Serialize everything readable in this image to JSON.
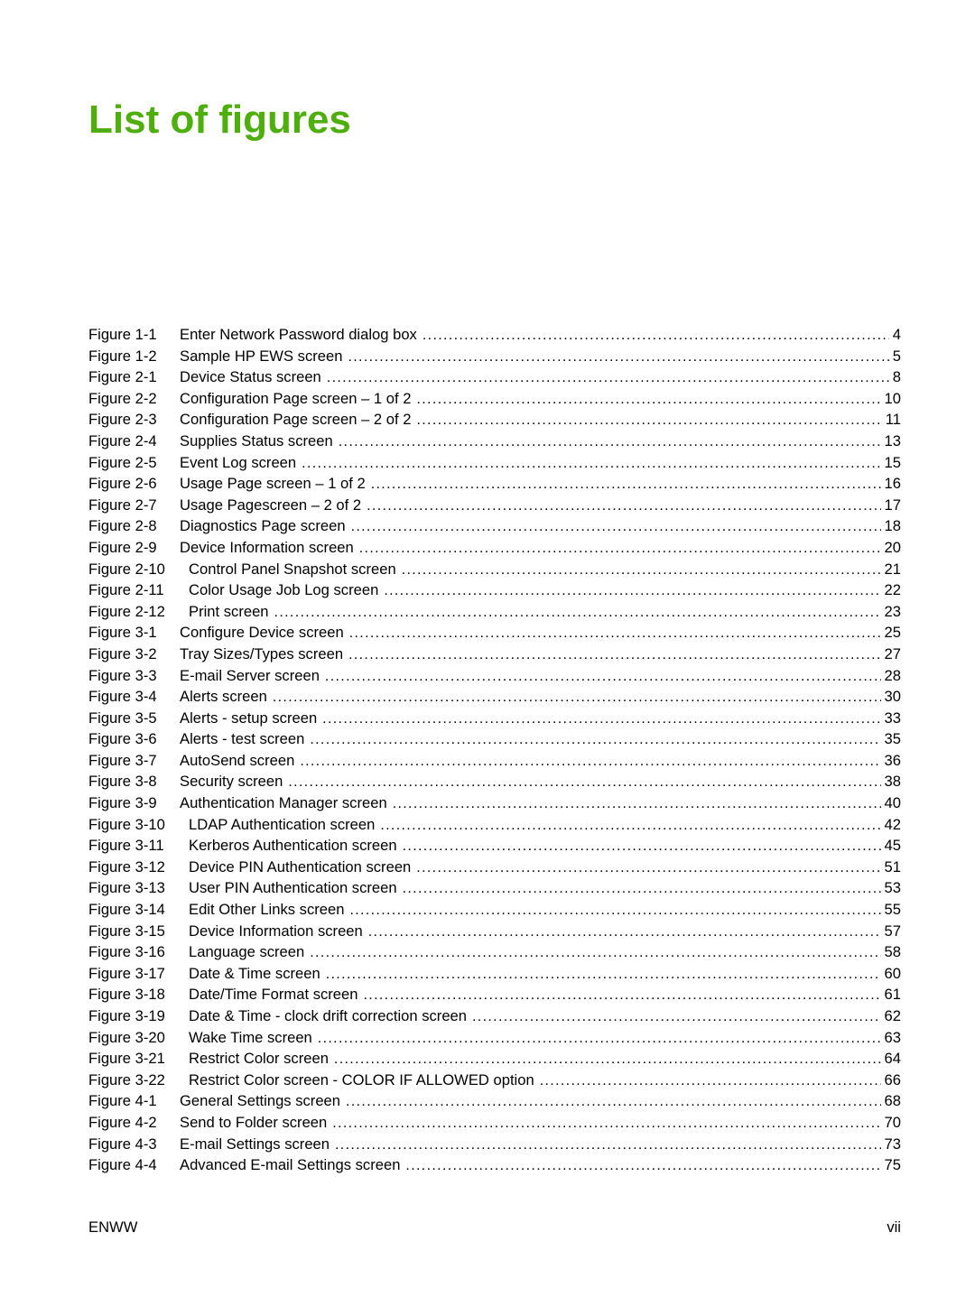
{
  "title": "List of figures",
  "accent_color": "#4eae0b",
  "entries": [
    {
      "figure": "Figure 1-1",
      "label": "Enter Network Password dialog box",
      "page": "4"
    },
    {
      "figure": "Figure 1-2",
      "label": "Sample HP EWS screen",
      "page": "5"
    },
    {
      "figure": "Figure 2-1",
      "label": "Device Status screen",
      "page": "8"
    },
    {
      "figure": "Figure 2-2",
      "label": "Configuration Page screen – 1 of 2",
      "page": "10"
    },
    {
      "figure": "Figure 2-3",
      "label": "Configuration Page screen – 2 of 2",
      "page": "11"
    },
    {
      "figure": "Figure 2-4",
      "label": "Supplies Status screen",
      "page": "13"
    },
    {
      "figure": "Figure 2-5",
      "label": "Event Log screen",
      "page": "15"
    },
    {
      "figure": "Figure 2-6",
      "label": "Usage Page screen – 1 of 2",
      "page": "16"
    },
    {
      "figure": "Figure 2-7",
      "label": "Usage Pagescreen – 2 of 2",
      "page": "17"
    },
    {
      "figure": "Figure 2-8",
      "label": "Diagnostics Page screen",
      "page": "18"
    },
    {
      "figure": "Figure 2-9",
      "label": "Device Information screen",
      "page": "20"
    },
    {
      "figure": "Figure 2-10",
      "label": "Control Panel Snapshot screen",
      "page": "21"
    },
    {
      "figure": "Figure 2-11",
      "label": "Color Usage Job Log screen",
      "page": "22"
    },
    {
      "figure": "Figure 2-12",
      "label": "Print screen",
      "page": "23"
    },
    {
      "figure": "Figure 3-1",
      "label": "Configure Device screen",
      "page": "25"
    },
    {
      "figure": "Figure 3-2",
      "label": "Tray Sizes/Types screen",
      "page": "27"
    },
    {
      "figure": "Figure 3-3",
      "label": "E-mail Server screen",
      "page": "28"
    },
    {
      "figure": "Figure 3-4",
      "label": "Alerts screen",
      "page": "30"
    },
    {
      "figure": "Figure 3-5",
      "label": "Alerts - setup screen",
      "page": "33"
    },
    {
      "figure": "Figure 3-6",
      "label": "Alerts - test screen",
      "page": "35"
    },
    {
      "figure": "Figure 3-7",
      "label": "AutoSend screen",
      "page": "36"
    },
    {
      "figure": "Figure 3-8",
      "label": "Security screen",
      "page": "38"
    },
    {
      "figure": "Figure 3-9",
      "label": "Authentication Manager screen",
      "page": "40"
    },
    {
      "figure": "Figure 3-10",
      "label": "LDAP Authentication screen",
      "page": "42"
    },
    {
      "figure": "Figure 3-11",
      "label": "Kerberos Authentication screen",
      "page": "45"
    },
    {
      "figure": "Figure 3-12",
      "label": "Device PIN Authentication screen",
      "page": "51"
    },
    {
      "figure": "Figure 3-13",
      "label": "User PIN Authentication screen",
      "page": "53"
    },
    {
      "figure": "Figure 3-14",
      "label": "Edit Other Links screen",
      "page": "55"
    },
    {
      "figure": "Figure 3-15",
      "label": "Device Information screen",
      "page": "57"
    },
    {
      "figure": "Figure 3-16",
      "label": "Language screen",
      "page": "58"
    },
    {
      "figure": "Figure 3-17",
      "label": "Date & Time screen",
      "page": "60"
    },
    {
      "figure": "Figure 3-18",
      "label": "Date/Time Format screen",
      "page": "61"
    },
    {
      "figure": "Figure 3-19",
      "label": "Date & Time - clock drift correction screen",
      "page": "62"
    },
    {
      "figure": "Figure 3-20",
      "label": "Wake Time screen",
      "page": "63"
    },
    {
      "figure": "Figure 3-21",
      "label": "Restrict Color screen",
      "page": "64"
    },
    {
      "figure": "Figure 3-22",
      "label": "Restrict Color screen - COLOR IF ALLOWED option",
      "page": "66"
    },
    {
      "figure": "Figure 4-1",
      "label": "General Settings screen",
      "page": "68"
    },
    {
      "figure": "Figure 4-2",
      "label": "Send to Folder screen",
      "page": "70"
    },
    {
      "figure": "Figure 4-3",
      "label": "E-mail Settings screen",
      "page": "73"
    },
    {
      "figure": "Figure 4-4",
      "label": "Advanced E-mail Settings screen",
      "page": "75"
    }
  ],
  "footer": {
    "left": "ENWW",
    "right": "vii"
  }
}
